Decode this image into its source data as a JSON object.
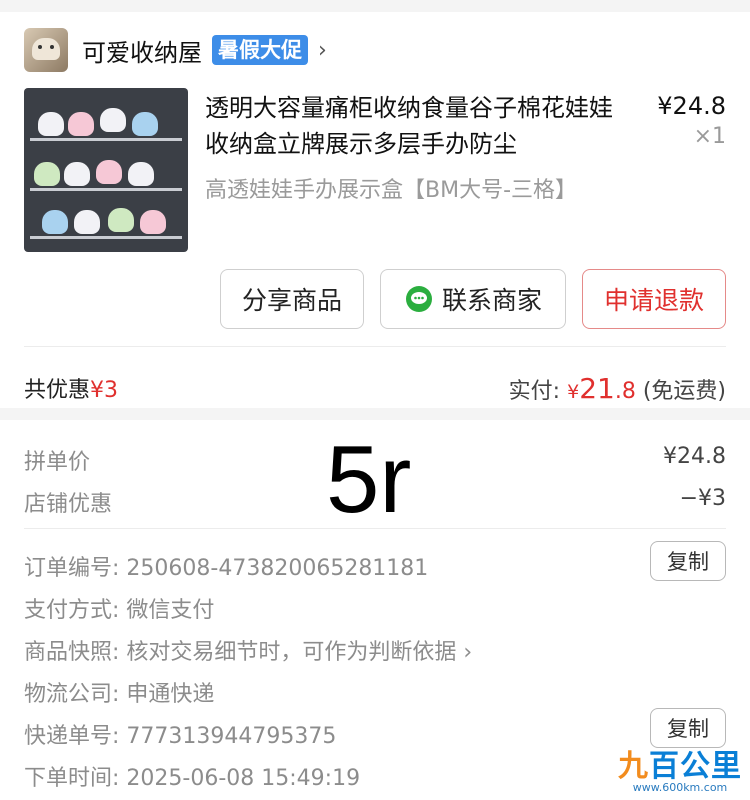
{
  "shop": {
    "name": "可爱收纳屋",
    "promo_badge": "暑假大促",
    "chevron": "›"
  },
  "product": {
    "title": "透明大容量痛柜收纳食量谷子棉花娃娃收纳盒立牌展示多层手办防尘",
    "spec": "高透娃娃手办展示盒【BM大号-三格】",
    "price": "¥24.8",
    "quantity": "×1"
  },
  "actions": {
    "share": "分享商品",
    "contact": "联系商家",
    "refund": "申请退款"
  },
  "summary": {
    "discount_label": "共优惠",
    "discount_value": "¥3",
    "paid_label": "实付:",
    "paid_currency": "¥",
    "paid_int": "21",
    "paid_dec": ".8",
    "shipping_note": "(免运费)"
  },
  "price_detail": {
    "group_price_label": "拼单价",
    "group_price_value": "¥24.8",
    "shop_discount_label": "店铺优惠",
    "shop_discount_value": "−¥3",
    "overlay_text": "5r"
  },
  "order_info": {
    "order_no_label": "订单编号:",
    "order_no": "250608-473820065281181",
    "pay_method_label": "支付方式:",
    "pay_method": "微信支付",
    "snapshot_label": "商品快照:",
    "snapshot_text": "核对交易细节时，可作为判断依据 ›",
    "logistics_label": "物流公司:",
    "logistics": "申通快递",
    "tracking_label": "快递单号:",
    "tracking_no": "777313944795375",
    "order_time_label": "下单时间:",
    "order_time": "2025-06-08 15:49:19",
    "copy_label": "复制"
  },
  "watermark": {
    "brand_prefix": "九",
    "brand_rest": "百公里",
    "url": "www.600km.com"
  },
  "colors": {
    "accent_red": "#e0302e",
    "badge_blue": "#3d8de8",
    "wechat_green": "#2bae3f"
  },
  "icons": [
    "shop-avatar",
    "chevron-right-icon",
    "wechat-chat-icon"
  ]
}
